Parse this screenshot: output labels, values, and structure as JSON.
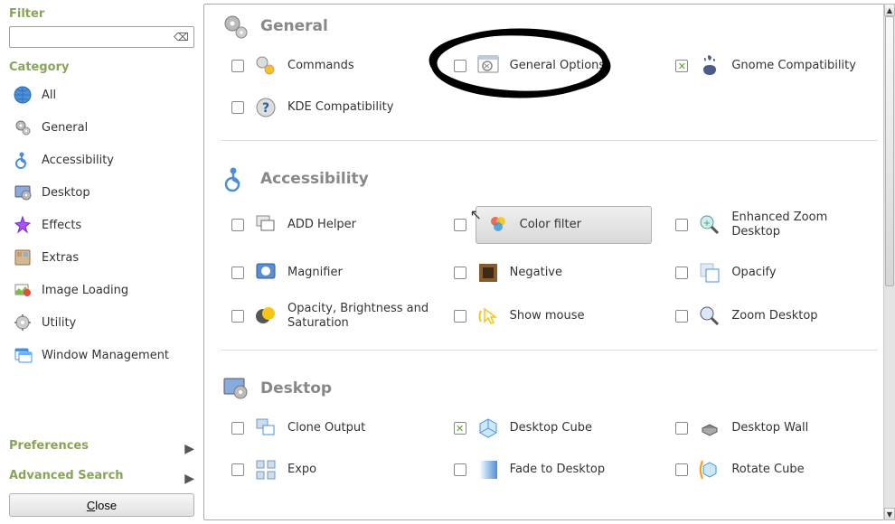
{
  "sidebar": {
    "filter_label": "Filter",
    "filter_value": "",
    "filter_placeholder": "",
    "category_label": "Category",
    "categories": [
      {
        "label": "All",
        "icon": "globe"
      },
      {
        "label": "General",
        "icon": "gears"
      },
      {
        "label": "Accessibility",
        "icon": "wheelchair"
      },
      {
        "label": "Desktop",
        "icon": "desktop-gear"
      },
      {
        "label": "Effects",
        "icon": "sparkle"
      },
      {
        "label": "Extras",
        "icon": "extras"
      },
      {
        "label": "Image Loading",
        "icon": "image-loading"
      },
      {
        "label": "Utility",
        "icon": "utility-gear"
      },
      {
        "label": "Window Management",
        "icon": "window"
      }
    ],
    "preferences_label": "Preferences",
    "advanced_search_label": "Advanced Search",
    "close_label": "Close"
  },
  "sections": [
    {
      "title": "General",
      "icon": "gears",
      "items": [
        {
          "label": "Commands",
          "checked": false,
          "icon": "commands"
        },
        {
          "label": "General Options",
          "checked": false,
          "icon": "general-options",
          "annotated": true
        },
        {
          "label": "Gnome Compatibility",
          "checked": true,
          "icon": "gnome"
        },
        {
          "label": "KDE Compatibility",
          "checked": false,
          "icon": "kde"
        }
      ]
    },
    {
      "title": "Accessibility",
      "icon": "wheelchair",
      "items": [
        {
          "label": "ADD Helper",
          "checked": false,
          "icon": "add-helper"
        },
        {
          "label": "Color filter",
          "checked": false,
          "icon": "color-filter",
          "selected": true
        },
        {
          "label": "Enhanced Zoom Desktop",
          "checked": false,
          "icon": "zoom-enh"
        },
        {
          "label": "Magnifier",
          "checked": false,
          "icon": "magnifier"
        },
        {
          "label": "Negative",
          "checked": false,
          "icon": "negative"
        },
        {
          "label": "Opacify",
          "checked": false,
          "icon": "opacify"
        },
        {
          "label": "Opacity, Brightness and Saturation",
          "checked": false,
          "icon": "obs"
        },
        {
          "label": "Show mouse",
          "checked": false,
          "icon": "show-mouse"
        },
        {
          "label": "Zoom Desktop",
          "checked": false,
          "icon": "zoom"
        }
      ]
    },
    {
      "title": "Desktop",
      "icon": "desktop-gear",
      "items": [
        {
          "label": "Clone Output",
          "checked": false,
          "icon": "clone"
        },
        {
          "label": "Desktop Cube",
          "checked": true,
          "icon": "cube"
        },
        {
          "label": "Desktop Wall",
          "checked": false,
          "icon": "wall"
        },
        {
          "label": "Expo",
          "checked": false,
          "icon": "expo"
        },
        {
          "label": "Fade to Desktop",
          "checked": false,
          "icon": "fade"
        },
        {
          "label": "Rotate Cube",
          "checked": false,
          "icon": "rotate"
        }
      ]
    }
  ]
}
